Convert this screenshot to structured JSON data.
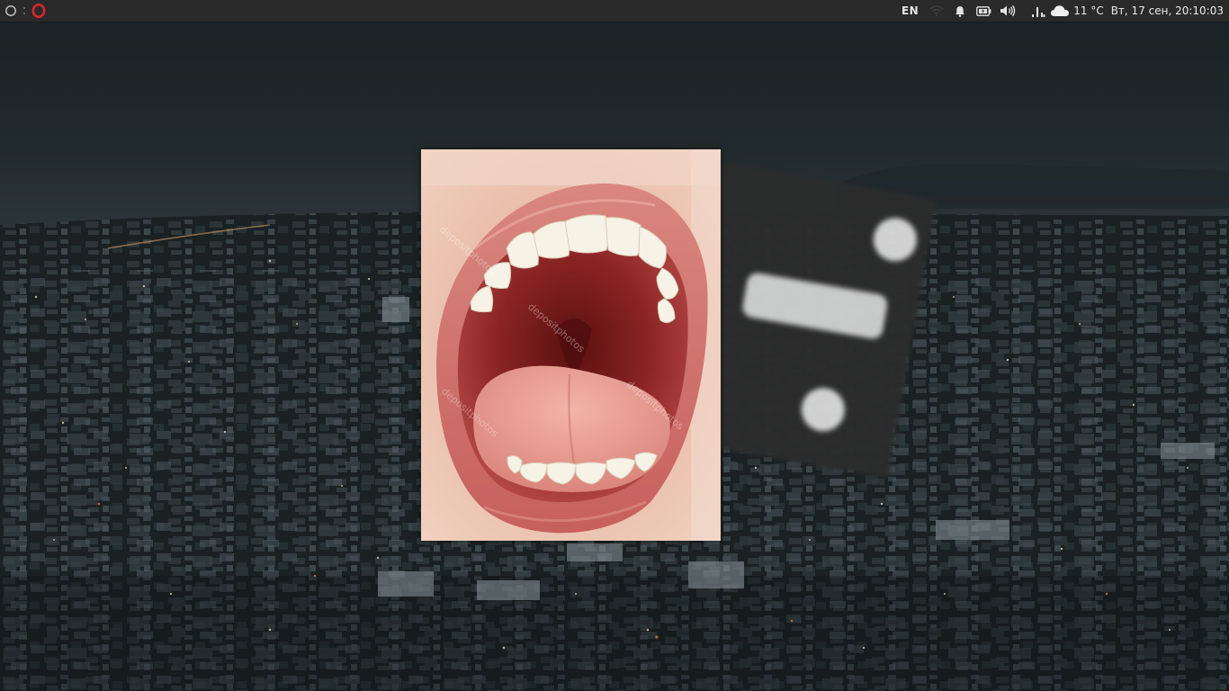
{
  "panel": {
    "keyboard_layout": "EN",
    "weather": "11 °C",
    "clock": "Вт, 17 сен, 20:10:03",
    "icons": {
      "menu": "circle-menu-icon",
      "separator": "vertical-dots-separator-icon",
      "browser": "opera-browser-icon",
      "network": "wifi-icon",
      "notifications": "bell-icon",
      "battery": "battery-icon",
      "sound": "speaker-volume-icon",
      "system_monitor": "bar-graph-icon",
      "weather": "cloud-icon"
    }
  },
  "photo": {
    "watermark": "depositphotos"
  },
  "colors": {
    "panel_bg": "#2a2a2a",
    "opera_red": "#d9262c",
    "sky_top": "#1d2326",
    "city_dark": "#141a1c"
  }
}
